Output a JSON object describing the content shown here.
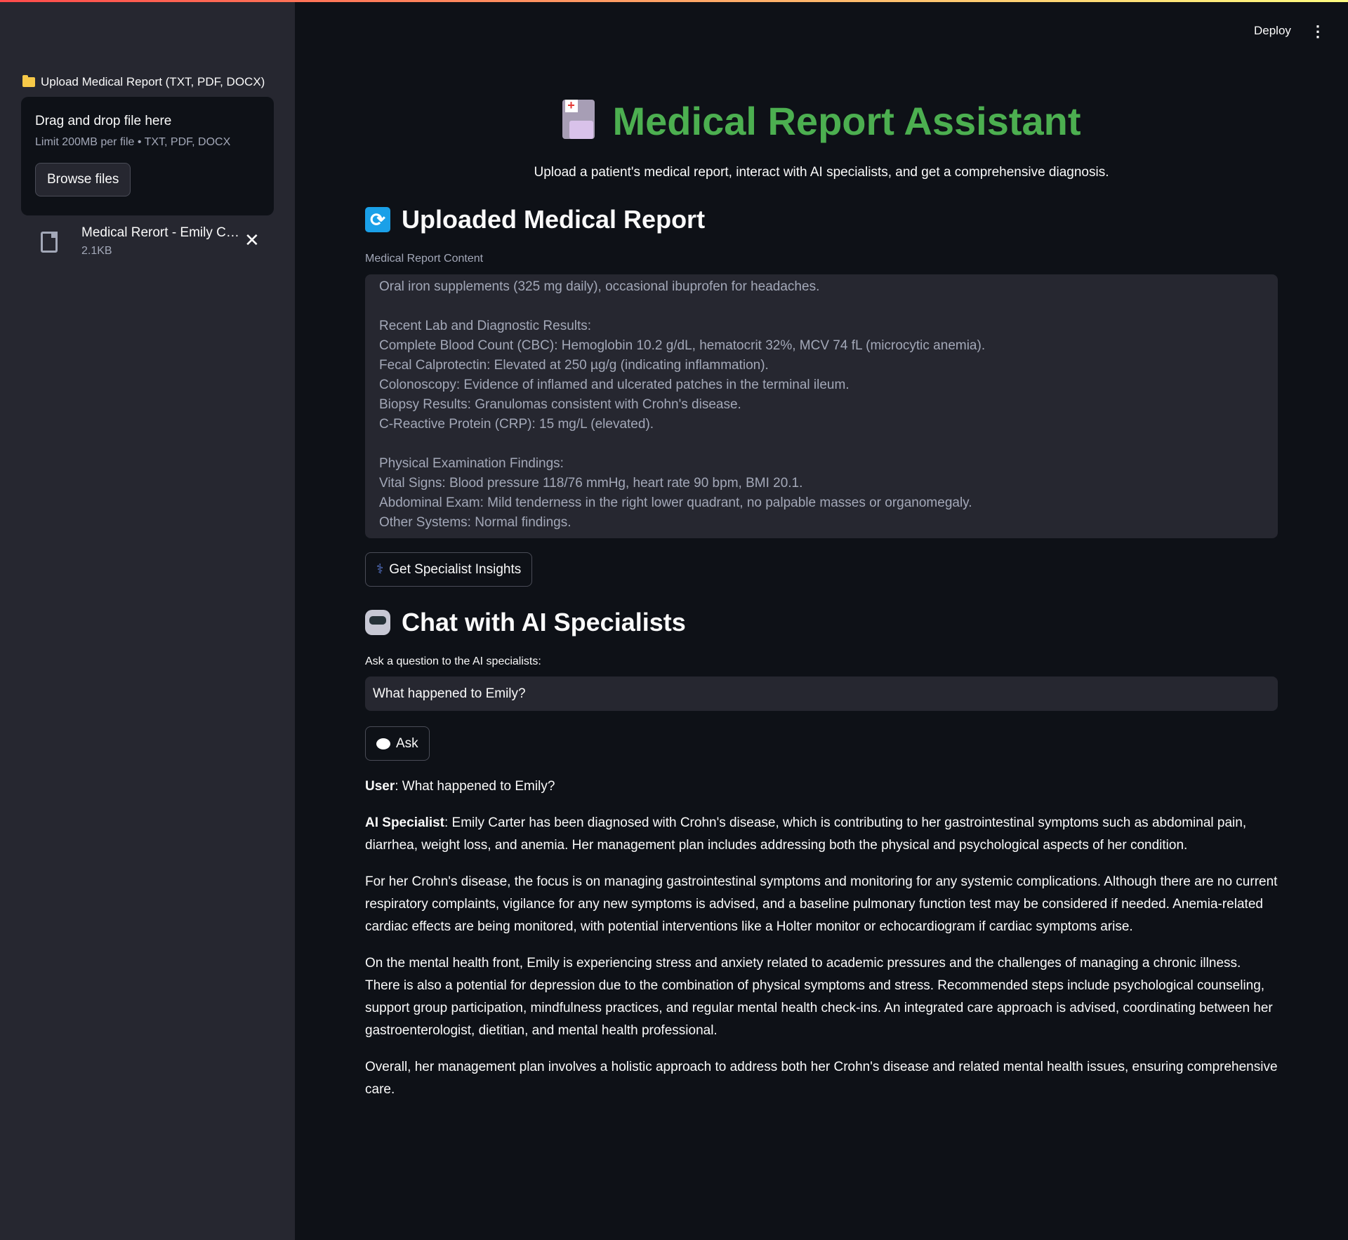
{
  "sidebar": {
    "upload_label": "Upload Medical Report (TXT, PDF, DOCX)",
    "dropzone_title": "Drag and drop file here",
    "dropzone_limit": "Limit 200MB per file • TXT, PDF, DOCX",
    "browse_label": "Browse files",
    "file": {
      "name": "Medical Rerort - Emily Ca...",
      "size": "2.1KB"
    }
  },
  "header": {
    "deploy_label": "Deploy",
    "menu_icon": "⋮"
  },
  "main": {
    "title": "Medical Report Assistant",
    "subtitle": "Upload a patient's medical report, interact with AI specialists, and get a comprehensive diagnosis.",
    "report_heading": "Uploaded Medical Report",
    "report_label": "Medical Report Content",
    "report_content": "Oral iron supplements (325 mg daily), occasional ibuprofen for headaches.\n\nRecent Lab and Diagnostic Results:\nComplete Blood Count (CBC): Hemoglobin 10.2 g/dL, hematocrit 32%, MCV 74 fL (microcytic anemia).\nFecal Calprotectin: Elevated at 250 µg/g (indicating inflammation).\nColonoscopy: Evidence of inflamed and ulcerated patches in the terminal ileum.\nBiopsy Results: Granulomas consistent with Crohn's disease.\nC-Reactive Protein (CRP): 15 mg/L (elevated).\n\nPhysical Examination Findings:\nVital Signs: Blood pressure 118/76 mmHg, heart rate 90 bpm, BMI 20.1.\nAbdominal Exam: Mild tenderness in the right lower quadrant, no palpable masses or organomegaly.\nOther Systems: Normal findings.",
    "insights_button": "Get Specialist Insights",
    "chat_heading": "Chat with AI Specialists",
    "question_label": "Ask a question to the AI specialists:",
    "question_value": "What happened to Emily?",
    "ask_button": "Ask",
    "user_label": "User",
    "user_message": ": What happened to Emily?",
    "ai_label": "AI Specialist",
    "ai_paragraphs": [
      ": Emily Carter has been diagnosed with Crohn's disease, which is contributing to her gastrointestinal symptoms such as abdominal pain, diarrhea, weight loss, and anemia. Her management plan includes addressing both the physical and psychological aspects of her condition.",
      "For her Crohn's disease, the focus is on managing gastrointestinal symptoms and monitoring for any systemic complications. Although there are no current respiratory complaints, vigilance for any new symptoms is advised, and a baseline pulmonary function test may be considered if needed. Anemia-related cardiac effects are being monitored, with potential interventions like a Holter monitor or echocardiogram if cardiac symptoms arise.",
      "On the mental health front, Emily is experiencing stress and anxiety related to academic pressures and the challenges of managing a chronic illness. There is also a potential for depression due to the combination of physical symptoms and stress. Recommended steps include psychological counseling, support group participation, mindfulness practices, and regular mental health check-ins. An integrated care approach is advised, coordinating between her gastroenterologist, dietitian, and mental health professional.",
      "Overall, her management plan involves a holistic approach to address both her Crohn's disease and related mental health issues, ensuring comprehensive care."
    ]
  },
  "colors": {
    "accent": "#4caf50",
    "background": "#0e1117",
    "sidebar": "#262730"
  }
}
